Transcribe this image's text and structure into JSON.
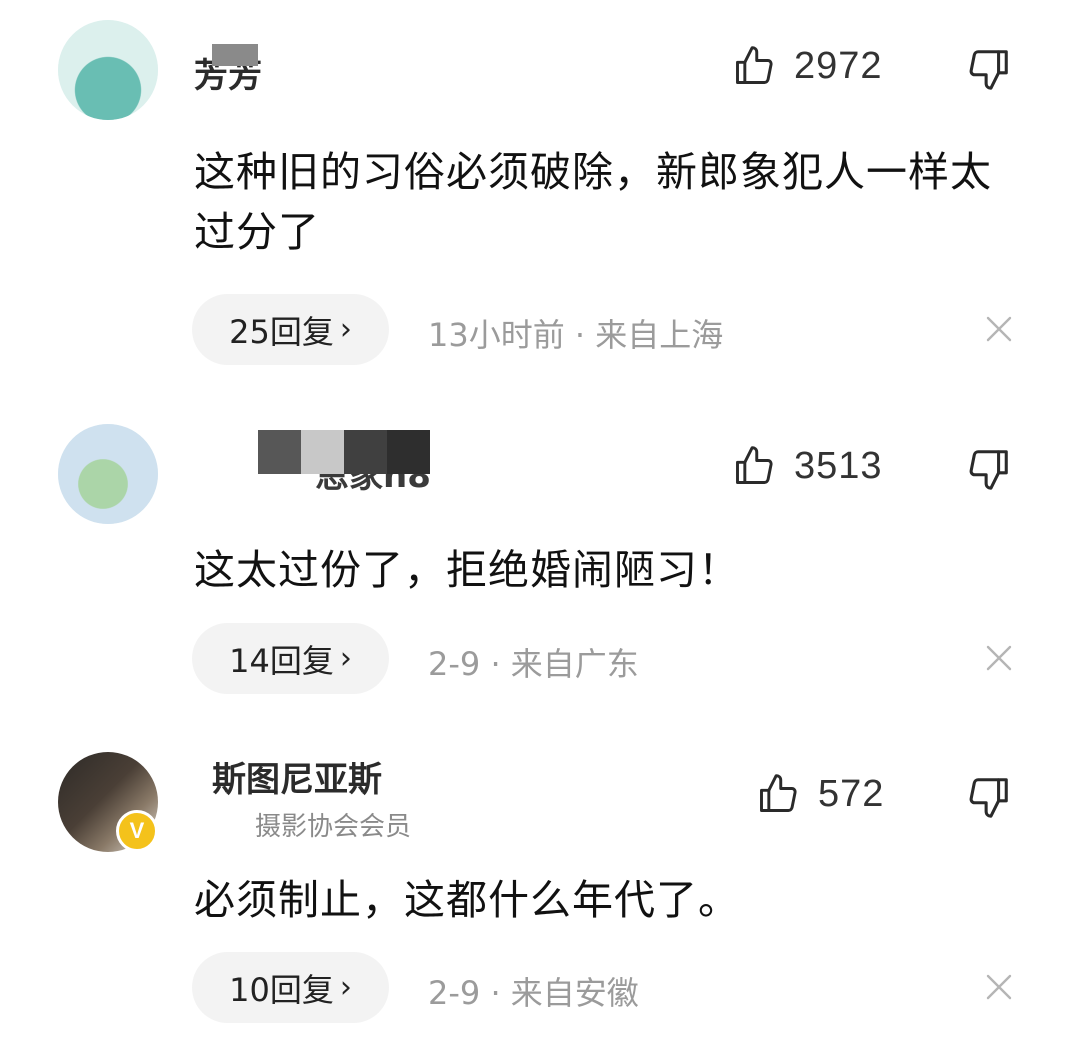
{
  "comments": [
    {
      "username": "芳芳",
      "subtitle": "",
      "likes": "2972",
      "text": "这种旧的习俗必须破除，新郎象犯人一样太过分了",
      "reply_count": "25回复",
      "meta": "13小时前 · 来自上海",
      "verified": false
    },
    {
      "username": "恩家n8",
      "subtitle": "",
      "likes": "3513",
      "text": "这太过份了，拒绝婚闹陋习！",
      "reply_count": "14回复",
      "meta": "2-9 · 来自广东",
      "verified": false
    },
    {
      "username": "斯图尼亚斯",
      "subtitle": "摄影协会会员",
      "likes": "572",
      "text": "必须制止，这都什么年代了。",
      "reply_count": "10回复",
      "meta": "2-9 · 来自安徽",
      "verified": true,
      "verified_badge": "V"
    }
  ],
  "icons": {
    "like": "thumbs-up-icon",
    "dislike": "thumbs-down-icon",
    "close": "close-icon",
    "chevron": "chevron-right-icon"
  },
  "colors": {
    "reply_pill_bg": "#f3f3f3",
    "meta_text": "#9b9b9b",
    "verified_badge": "#f4c21b"
  }
}
